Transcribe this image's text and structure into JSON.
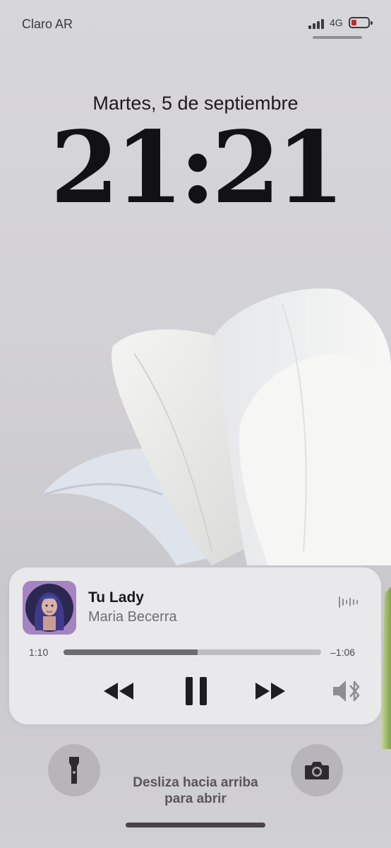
{
  "status_bar": {
    "carrier": "Claro AR",
    "network": "4G",
    "battery_level": 0.25,
    "battery_color": "#c1272d"
  },
  "lock_screen": {
    "date": "Martes, 5 de septiembre",
    "time": "21:21"
  },
  "now_playing": {
    "title": "Tu Lady",
    "artist": "Maria Becerra",
    "elapsed": "1:10",
    "remaining": "–1:06",
    "progress": 0.52,
    "icons": {
      "waveform": "waveform-icon",
      "rewind": "rewind-icon",
      "pause": "pause-icon",
      "forward": "fast-forward-icon",
      "audio_output": "speaker-bluetooth-icon"
    }
  },
  "bottom": {
    "hint_line1": "Desliza hacia arriba",
    "hint_line2": "para abrir",
    "left_button_icon": "flashlight-icon",
    "right_button_icon": "camera-icon"
  }
}
